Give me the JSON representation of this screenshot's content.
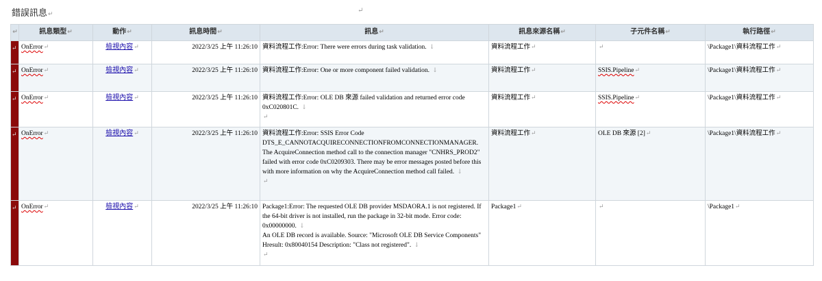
{
  "page": {
    "title": "錯誤訊息",
    "para_mark": "↵",
    "line_mark": "↓"
  },
  "table": {
    "headers": [
      "訊息類型",
      "動作",
      "訊息時間",
      "訊息",
      "訊息來源名稱",
      "子元件名稱",
      "執行路徑"
    ],
    "rows": [
      {
        "type": "OnError",
        "action": "檢視內容",
        "time": "2022/3/25 上午 11:26:10",
        "message": [
          "資料流程工作:Error: There were errors during task validation."
        ],
        "source": "資料流程工作",
        "subcomponent": "",
        "path": "\\Package1\\資料流程工作"
      },
      {
        "type": "OnError",
        "action": "檢視內容",
        "time": "2022/3/25 上午 11:26:10",
        "message": [
          "資料流程工作:Error: One or more component failed validation."
        ],
        "source": "資料流程工作",
        "subcomponent": "SSIS.Pipeline",
        "path": "\\Package1\\資料流程工作"
      },
      {
        "type": "OnError",
        "action": "檢視內容",
        "time": "2022/3/25 上午 11:26:10",
        "message": [
          "資料流程工作:Error: OLE DB 來源 failed validation and returned error code 0xC020801C."
        ],
        "source": "資料流程工作",
        "subcomponent": "SSIS.Pipeline",
        "path": "\\Package1\\資料流程工作"
      },
      {
        "type": "OnError",
        "action": "檢視內容",
        "time": "2022/3/25 上午 11:26:10",
        "message": [
          "資料流程工作:Error: SSIS Error Code DTS_E_CANNOTACQUIRECONNECTIONFROMCONNECTIONMANAGER. The AcquireConnection method call to the connection manager \"CNHRS_PROD2\" failed with error code 0xC0209303.  There may be error messages posted before this with more information on why the AcquireConnection method call failed."
        ],
        "source": "資料流程工作",
        "subcomponent": "OLE DB 來源 [2]",
        "path": "\\Package1\\資料流程工作"
      },
      {
        "type": "OnError",
        "action": "檢視內容",
        "time": "2022/3/25 上午 11:26:10",
        "message": [
          "Package1:Error: The requested OLE DB provider MSDAORA.1 is not registered. If the 64-bit driver is not installed, run the package in 32-bit mode. Error code: 0x00000000.",
          "An OLE DB record is available.  Source: \"Microsoft OLE DB Service Components\"  Hresult: 0x80040154  Description: \"Class not registered\"."
        ],
        "source": "Package1",
        "subcomponent": "",
        "path": "\\Package1"
      }
    ]
  }
}
